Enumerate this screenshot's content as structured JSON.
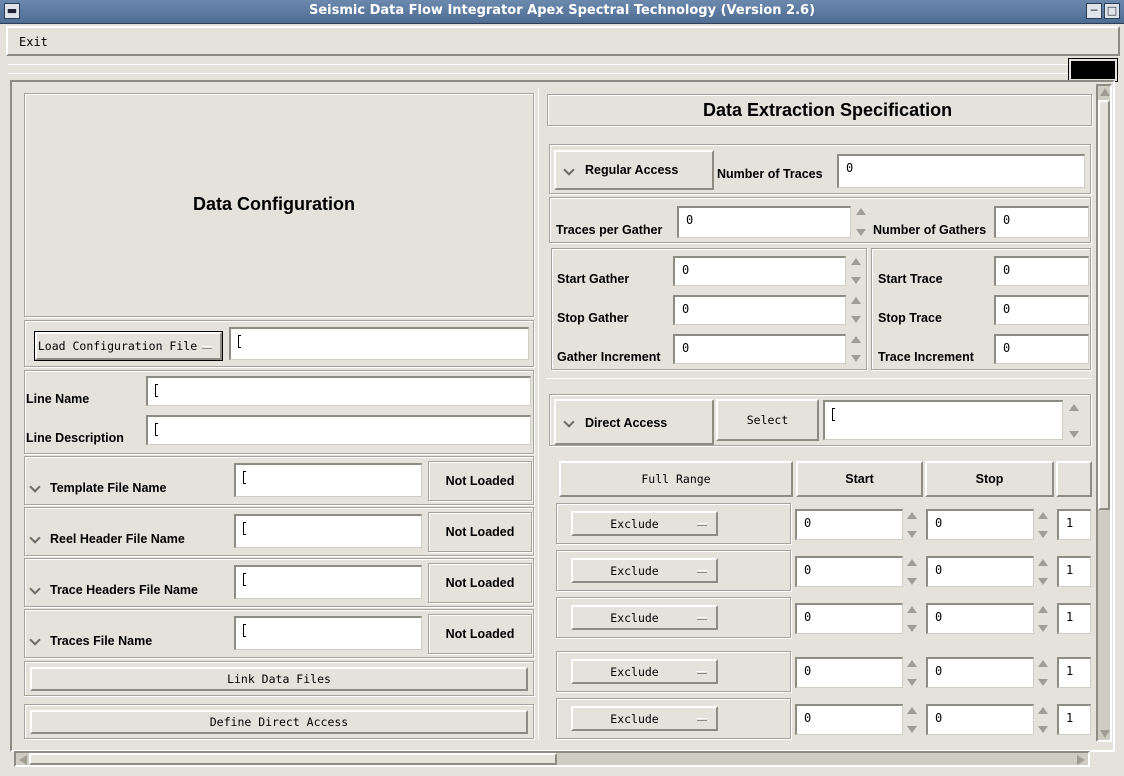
{
  "window": {
    "title": "Seismic Data Flow Integrator Apex Spectral Technology (Version 2.6)"
  },
  "menu": {
    "exit": "Exit"
  },
  "config": {
    "heading": "Data Configuration",
    "load_button": "Load Configuration File",
    "load_path": "",
    "line_name_label": "Line Name",
    "line_name_value": "",
    "line_desc_label": "Line Description",
    "line_desc_value": "",
    "files": [
      {
        "label": "Template File Name",
        "value": "",
        "status": "Not Loaded"
      },
      {
        "label": "Reel Header File Name",
        "value": "",
        "status": "Not Loaded"
      },
      {
        "label": "Trace Headers File Name",
        "value": "",
        "status": "Not Loaded"
      },
      {
        "label": "Traces File Name",
        "value": "",
        "status": "Not Loaded"
      }
    ],
    "link_button": "Link Data Files",
    "define_button": "Define Direct Access"
  },
  "extraction": {
    "heading": "Data Extraction Specification",
    "regular_access": "Regular Access",
    "number_of_traces_label": "Number of Traces",
    "number_of_traces": "0",
    "traces_per_gather_label": "Traces per Gather",
    "traces_per_gather": "0",
    "number_of_gathers_label": "Number of Gathers",
    "number_of_gathers": "0",
    "start_gather_label": "Start Gather",
    "start_gather": "0",
    "stop_gather_label": "Stop Gather",
    "stop_gather": "0",
    "gather_increment_label": "Gather Increment",
    "gather_increment": "0",
    "start_trace_label": "Start Trace",
    "start_trace": "0",
    "stop_trace_label": "Stop Trace",
    "stop_trace": "0",
    "trace_increment_label": "Trace Increment",
    "trace_increment": "0",
    "direct_access": "Direct Access",
    "select_button": "Select",
    "select_value": "",
    "full_range": "Full Range",
    "col_start": "Start",
    "col_stop": "Stop",
    "rows": [
      {
        "mode": "Exclude",
        "start": "0",
        "stop": "0",
        "inc": "1"
      },
      {
        "mode": "Exclude",
        "start": "0",
        "stop": "0",
        "inc": "1"
      },
      {
        "mode": "Exclude",
        "start": "0",
        "stop": "0",
        "inc": "1"
      },
      {
        "mode": "Exclude",
        "start": "0",
        "stop": "0",
        "inc": "1"
      },
      {
        "mode": "Exclude",
        "start": "0",
        "stop": "0",
        "inc": "1"
      }
    ]
  }
}
